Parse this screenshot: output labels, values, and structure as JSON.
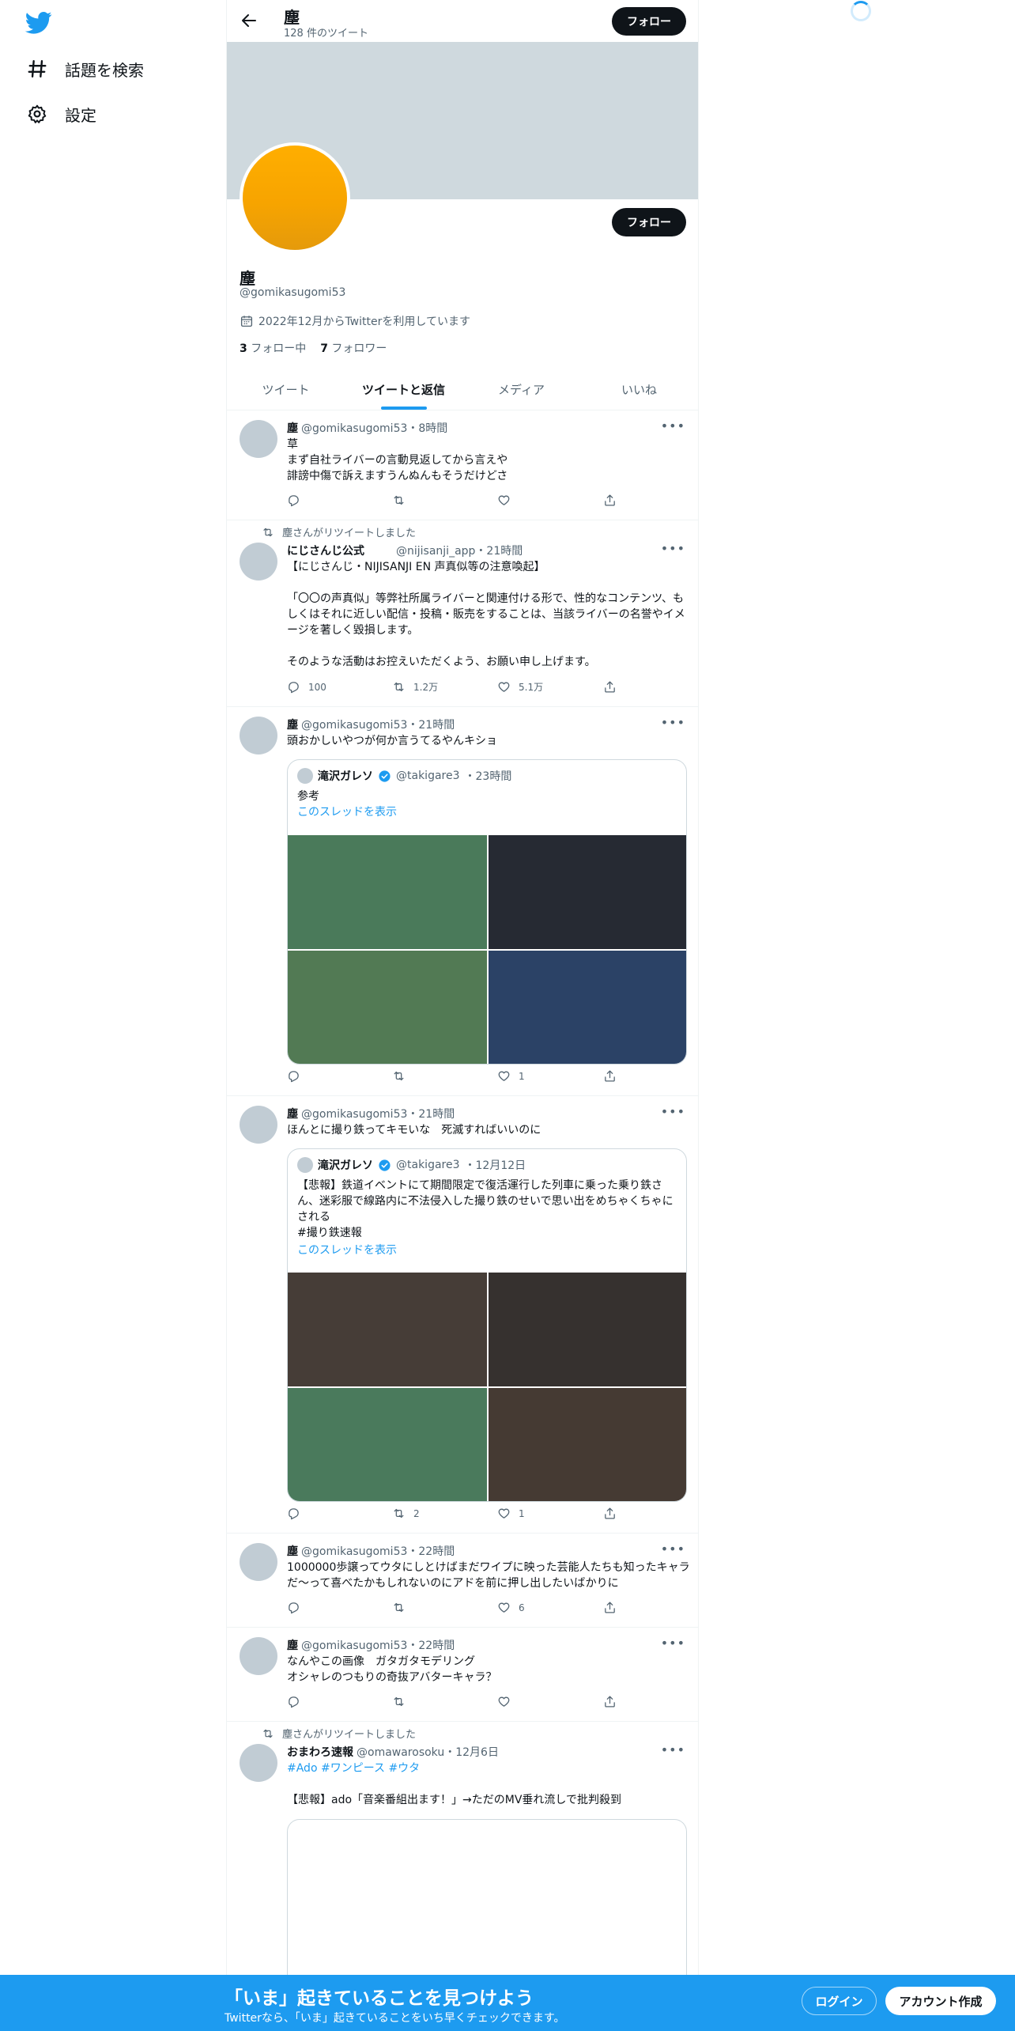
{
  "nav": {
    "explore_label": "話題を検索",
    "settings_label": "設定"
  },
  "header": {
    "name": "塵",
    "tweet_count": "128 件のツイート",
    "follow_label": "フォロー"
  },
  "profile": {
    "name": "塵",
    "handle": "@gomikasugomi53",
    "joined": "2022年12月からTwitterを利用しています",
    "following_count": "3",
    "following_label": "フォロー中",
    "followers_count": "7",
    "followers_label": "フォロワー",
    "follow_label": "フォロー",
    "avatar_color": "#ffae00",
    "banner_color": "#cfd9de"
  },
  "tabs": [
    "ツイート",
    "ツイートと返信",
    "メディア",
    "いいね"
  ],
  "tweets": [
    {
      "name": "塵",
      "handle": "@gomikasugomi53",
      "time": "・8時間",
      "text": "草\nまず自社ライバーの言動見返してから言えや\n誹謗中傷で訴えますうんぬんもそうだけどさ",
      "reply": "",
      "retweet": "",
      "like": ""
    },
    {
      "retweet_note": "塵さんがリツイートしました",
      "name": "にじさんじ公式",
      "handle": "@nijisanji_app",
      "time": "・21時間",
      "text": "【にじさんじ・NIJISANJI EN 声真似等の注意喚起】\n\n「〇〇の声真似」等弊社所属ライバーと関連付ける形で、性的なコンテンツ、もしくはそれに近しい配信・投稿・販売をすることは、当該ライバーの名誉やイメージを著しく毀損します。\n\nそのような活動はお控えいただくよう、お願い申し上げます。",
      "reply": "100",
      "retweet": "1.2万",
      "like": "5.1万"
    },
    {
      "name": "塵",
      "handle": "@gomikasugomi53",
      "time": "・21時間",
      "text": "頭おかしいやつが何か言うてるやんキショ",
      "quote": {
        "name": "滝沢ガレソ",
        "handle": "@takigare3",
        "time": "・23時間",
        "text": "参考",
        "thread_link": "このスレッドを表示",
        "image_colors": [
          "#4a7a5a",
          "#262a33",
          "#527a54",
          "#2b4266"
        ]
      },
      "reply": "",
      "retweet": "",
      "like": "1"
    },
    {
      "name": "塵",
      "handle": "@gomikasugomi53",
      "time": "・21時間",
      "text": "ほんとに撮り鉄ってキモいな　死滅すればいいのに",
      "quote": {
        "name": "滝沢ガレソ",
        "handle": "@takigare3",
        "time": "・12月12日",
        "text": "【悲報】鉄道イベントにて期間限定で復活運行した列車に乗った乗り鉄さん、迷彩服で線路内に不法侵入した撮り鉄のせいで思い出をめちゃくちゃにされる\n#撮り鉄速報",
        "thread_link": "このスレッドを表示",
        "image_colors": [
          "#463d37",
          "#36312f",
          "#4a7a5c",
          "#453a33"
        ]
      },
      "reply": "",
      "retweet": "2",
      "like": "1"
    },
    {
      "name": "塵",
      "handle": "@gomikasugomi53",
      "time": "・22時間",
      "text": "1000000歩譲ってウタにしとけばまだワイプに映った芸能人たちも知ったキャラだ〜って喜べたかもしれないのにアドを前に押し出したいばかりに",
      "reply": "",
      "retweet": "",
      "like": "6"
    },
    {
      "name": "塵",
      "handle": "@gomikasugomi53",
      "time": "・22時間",
      "text": "なんやこの画像　ガタガタモデリング\nオシャレのつもりの奇抜アバターキャラ？",
      "reply": "",
      "retweet": "",
      "like": ""
    },
    {
      "retweet_note": "塵さんがリツイートしました",
      "name": "おまわろ速報",
      "handle": "@omawarosoku",
      "time": "・12月6日",
      "hashtags": "#Ado #ワンピース #ウタ",
      "text": "【悲報】ado「音楽番組出ます！」→ただのMV垂れ流しで批判殺到"
    }
  ],
  "bottom_bar": {
    "title": "「いま」起きていることを見つけよう",
    "subtitle": "Twitterなら、「いま」起きていることをいち早くチェックできます。",
    "login": "ログイン",
    "signup": "アカウント作成"
  },
  "colors": {
    "accent": "#1d9bf0",
    "text": "#0f1419",
    "muted": "#536471"
  }
}
